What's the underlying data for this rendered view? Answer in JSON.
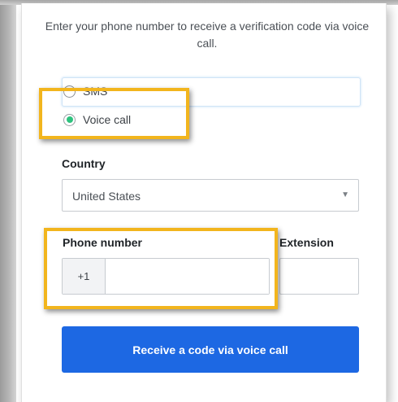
{
  "intro_text": "Enter your phone number to receive a verification code via voice call.",
  "delivery_options": [
    {
      "label": "SMS",
      "selected": false
    },
    {
      "label": "Voice call",
      "selected": true
    }
  ],
  "country": {
    "label": "Country",
    "value": "United States"
  },
  "phone": {
    "label": "Phone number",
    "prefix": "+1",
    "value": ""
  },
  "extension": {
    "label": "Extension",
    "value": ""
  },
  "submit_label": "Receive a code via voice call",
  "colors": {
    "accent": "#1d68e3",
    "highlight": "#f2b51d",
    "radio_selected": "#2ec27e"
  }
}
